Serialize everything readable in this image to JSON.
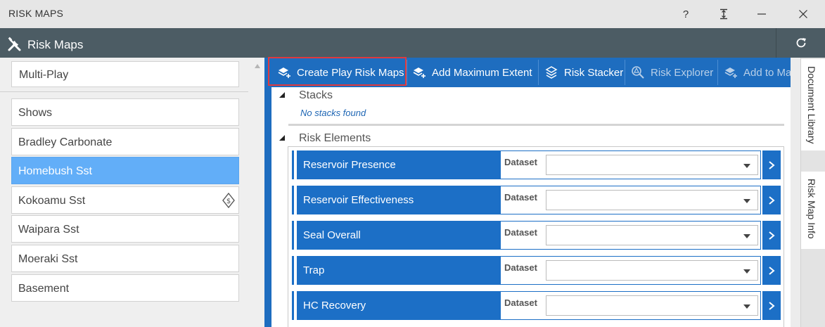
{
  "window": {
    "title": "RISK MAPS",
    "help_label": "?"
  },
  "header": {
    "title": "Risk Maps"
  },
  "left_panel": {
    "play_selector": "Multi-Play",
    "plays": [
      {
        "label": "Shows",
        "selected": false
      },
      {
        "label": "Bradley Carbonate",
        "selected": false
      },
      {
        "label": "Homebush Sst",
        "selected": true
      },
      {
        "label": "Kokoamu Sst",
        "selected": false,
        "badge_icon": "dollar-diamond-icon"
      },
      {
        "label": "Waipara Sst",
        "selected": false
      },
      {
        "label": "Moeraki Sst",
        "selected": false
      },
      {
        "label": "Basement",
        "selected": false
      }
    ]
  },
  "toolbar": {
    "buttons": [
      {
        "label": "Create Play Risk Maps",
        "icon": "layers-add-icon",
        "enabled": true,
        "highlighted": true
      },
      {
        "label": "Add Maximum Extent",
        "icon": "layers-add-icon",
        "enabled": true
      },
      {
        "label": "Risk Stacker",
        "icon": "stack-icon",
        "enabled": true
      },
      {
        "label": "Risk Explorer",
        "icon": "explorer-icon",
        "enabled": false
      },
      {
        "label": "Add to Map",
        "icon": "layers-add-icon",
        "enabled": false
      }
    ]
  },
  "stacks": {
    "label": "Stacks",
    "empty_text": "No stacks found"
  },
  "risk_elements": {
    "label": "Risk Elements",
    "dataset_label": "Dataset",
    "items": [
      {
        "name": "Reservoir Presence",
        "dataset": ""
      },
      {
        "name": "Reservoir Effectiveness",
        "dataset": ""
      },
      {
        "name": "Seal Overall",
        "dataset": ""
      },
      {
        "name": "Trap",
        "dataset": ""
      },
      {
        "name": "HC Recovery",
        "dataset": ""
      }
    ]
  },
  "side_tabs": {
    "document_library": "Document Library",
    "risk_map_info": "Risk Map Info"
  },
  "colors": {
    "header_bg": "#4c5c64",
    "accent_blue": "#1c6fc6",
    "selected_item": "#62aef8",
    "highlight": "#e0393e"
  }
}
